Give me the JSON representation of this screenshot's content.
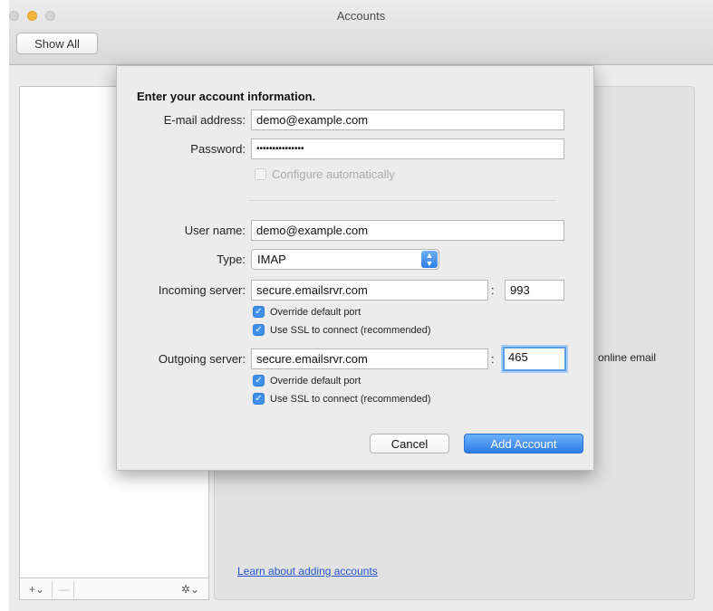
{
  "window": {
    "title": "Accounts",
    "show_all_label": "Show All"
  },
  "list_toolbar": {
    "add_label": "+⌄",
    "remove_label": "—",
    "gear_label": "✲⌄"
  },
  "right_panel": {
    "partial_text": "online email",
    "learn_link": "Learn about adding accounts"
  },
  "dialog": {
    "heading": "Enter your account information.",
    "email_label": "E-mail address:",
    "email_value": "demo@example.com",
    "password_label": "Password:",
    "password_value": "•••••••••••••••",
    "configure_auto_label": "Configure automatically",
    "username_label": "User name:",
    "username_value": "demo@example.com",
    "type_label": "Type:",
    "type_value": "IMAP",
    "incoming_label": "Incoming server:",
    "incoming_server": "secure.emailsrvr.com",
    "incoming_port": "993",
    "incoming_override_label": "Override default port",
    "incoming_ssl_label": "Use SSL to connect (recommended)",
    "outgoing_label": "Outgoing server:",
    "outgoing_server": "secure.emailsrvr.com",
    "outgoing_port": "465",
    "outgoing_override_label": "Override default port",
    "outgoing_ssl_label": "Use SSL to connect (recommended)",
    "colon": ":",
    "cancel_label": "Cancel",
    "add_account_label": "Add Account"
  },
  "colors": {
    "accent": "#3f8fe8",
    "link": "#2255cc"
  }
}
